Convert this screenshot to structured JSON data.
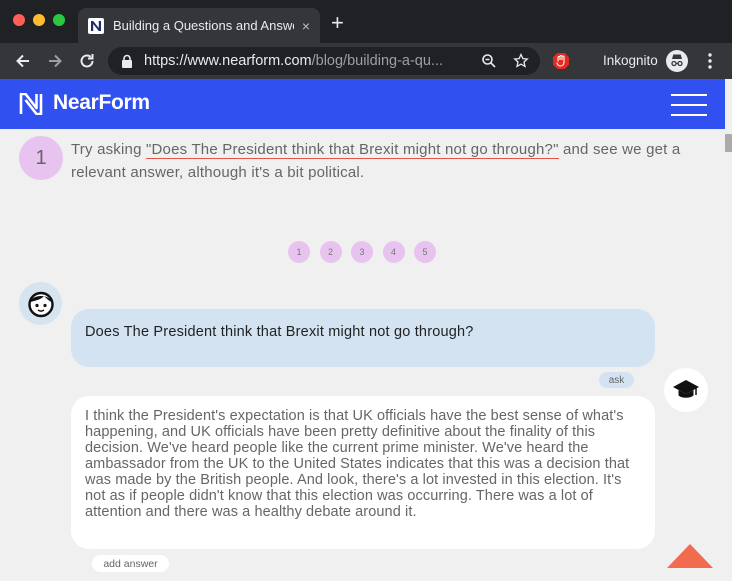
{
  "browser": {
    "tab_title": "Building a Questions and Answers",
    "new_tab_symbol": "+",
    "close_symbol": "×",
    "url_host": "https://www.nearform.com",
    "url_path": "/blog/building-a-qu...",
    "profile_label": "Inkognito"
  },
  "site": {
    "brand": "NearForm",
    "brand_color": "#3050f0"
  },
  "step": {
    "number": "1",
    "tip_prefix": "Try asking ",
    "tip_question": "\"Does The President think that Brexit might not go through?\"",
    "tip_suffix": " and see we get a relevant answer, although it's a bit political."
  },
  "pagination": [
    "1",
    "2",
    "3",
    "4",
    "5"
  ],
  "chat": {
    "question": "Does The President think that Brexit might not go through?",
    "ask_label": "ask",
    "answer": "I think the President's expectation is that UK officials have the best sense of what's happening, and UK officials have been pretty definitive about the finality of this decision. We've heard people like the current prime minister. We've heard the ambassador from the UK to the United States indicates that this was a decision that was made by the British people. And look, there's a lot invested in this election. It's not as if people didn't know that this election was occurring. There was a lot of attention and there was a healthy debate around it.",
    "add_answer_label": "add answer"
  },
  "icons": {
    "user_avatar": "boy-face-icon",
    "bot_avatar": "graduation-cap-icon",
    "scroll_top": "up-triangle-icon"
  },
  "colors": {
    "badge": "#e8c3ef",
    "question_bubble": "#d3e3f1",
    "underline": "#e0564a",
    "scroll_top": "#f26b4f"
  }
}
